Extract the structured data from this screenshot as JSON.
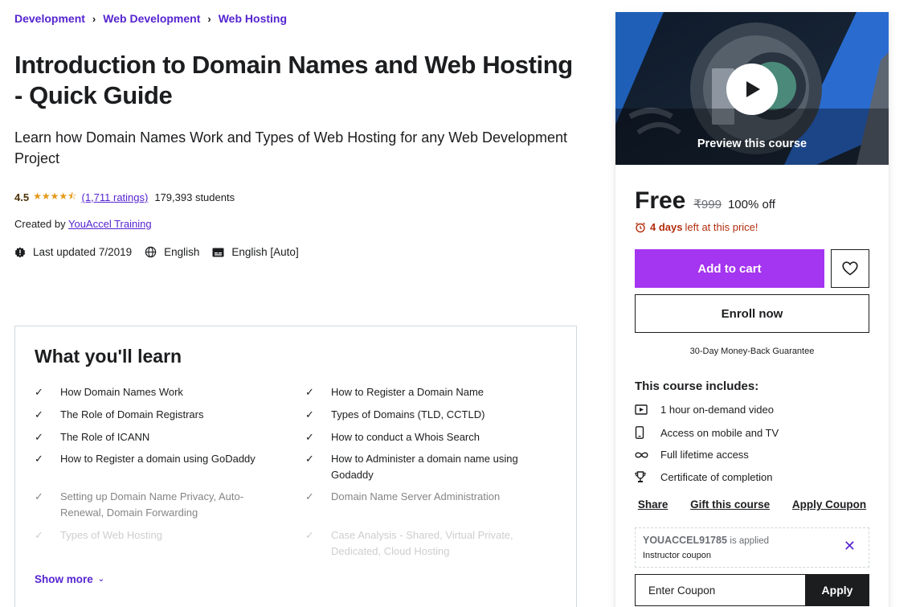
{
  "breadcrumb": {
    "items": [
      "Development",
      "Web Development",
      "Web Hosting"
    ],
    "separator": "›"
  },
  "course": {
    "title": "Introduction to Domain Names and Web Hosting - Quick Guide",
    "subtitle": "Learn how Domain Names Work and Types of Web Hosting for any Web Development Project",
    "rating": "4.5",
    "stars_value": 4.5,
    "ratings_count": "(1,711 ratings)",
    "students": "179,393 students",
    "created_by_label": "Created by",
    "instructor": "YouAccel Training",
    "last_updated": "Last updated 7/2019",
    "language": "English",
    "captions": "English [Auto]"
  },
  "learn": {
    "title": "What you'll learn",
    "check_icon": "check-icon",
    "items": [
      "How Domain Names Work",
      "How to Register a Domain Name",
      "The Role of Domain Registrars",
      "Types of Domains (TLD, CCTLD)",
      "The Role of ICANN",
      "How to conduct a Whois Search",
      "How to Register a domain using GoDaddy",
      "How to Administer a domain name using Godaddy",
      "Setting up Domain Name Privacy, Auto-Renewal, Domain Forwarding",
      "Domain Name Server Administration",
      "Types of Web Hosting",
      "Case Analysis - Shared, Virtual Private, Dedicated, Cloud Hosting"
    ],
    "show_more": "Show more"
  },
  "sidebar": {
    "preview_label": "Preview this course",
    "price": "Free",
    "original_price": "₹999",
    "discount": "100% off",
    "deadline_days": "4 days",
    "deadline_text": "left at this price!",
    "add_to_cart": "Add to cart",
    "enroll": "Enroll now",
    "guarantee": "30-Day Money-Back Guarantee",
    "includes_title": "This course includes:",
    "includes": [
      {
        "icon": "video-icon",
        "text": "1 hour on-demand video"
      },
      {
        "icon": "mobile-icon",
        "text": "Access on mobile and TV"
      },
      {
        "icon": "infinity-icon",
        "text": "Full lifetime access"
      },
      {
        "icon": "trophy-icon",
        "text": "Certificate of completion"
      }
    ],
    "share": "Share",
    "gift": "Gift this course",
    "apply_coupon": "Apply Coupon",
    "coupon_code": "YOUACCEL91785",
    "coupon_applied": "is applied",
    "coupon_type": "Instructor coupon",
    "coupon_placeholder": "Enter Coupon",
    "apply": "Apply"
  },
  "colors": {
    "accent_purple": "#a435f0",
    "link_purple": "#5624d0",
    "star_orange": "#e59819",
    "deadline_red": "#b32d0f",
    "text_dark": "#1c1d1f"
  }
}
